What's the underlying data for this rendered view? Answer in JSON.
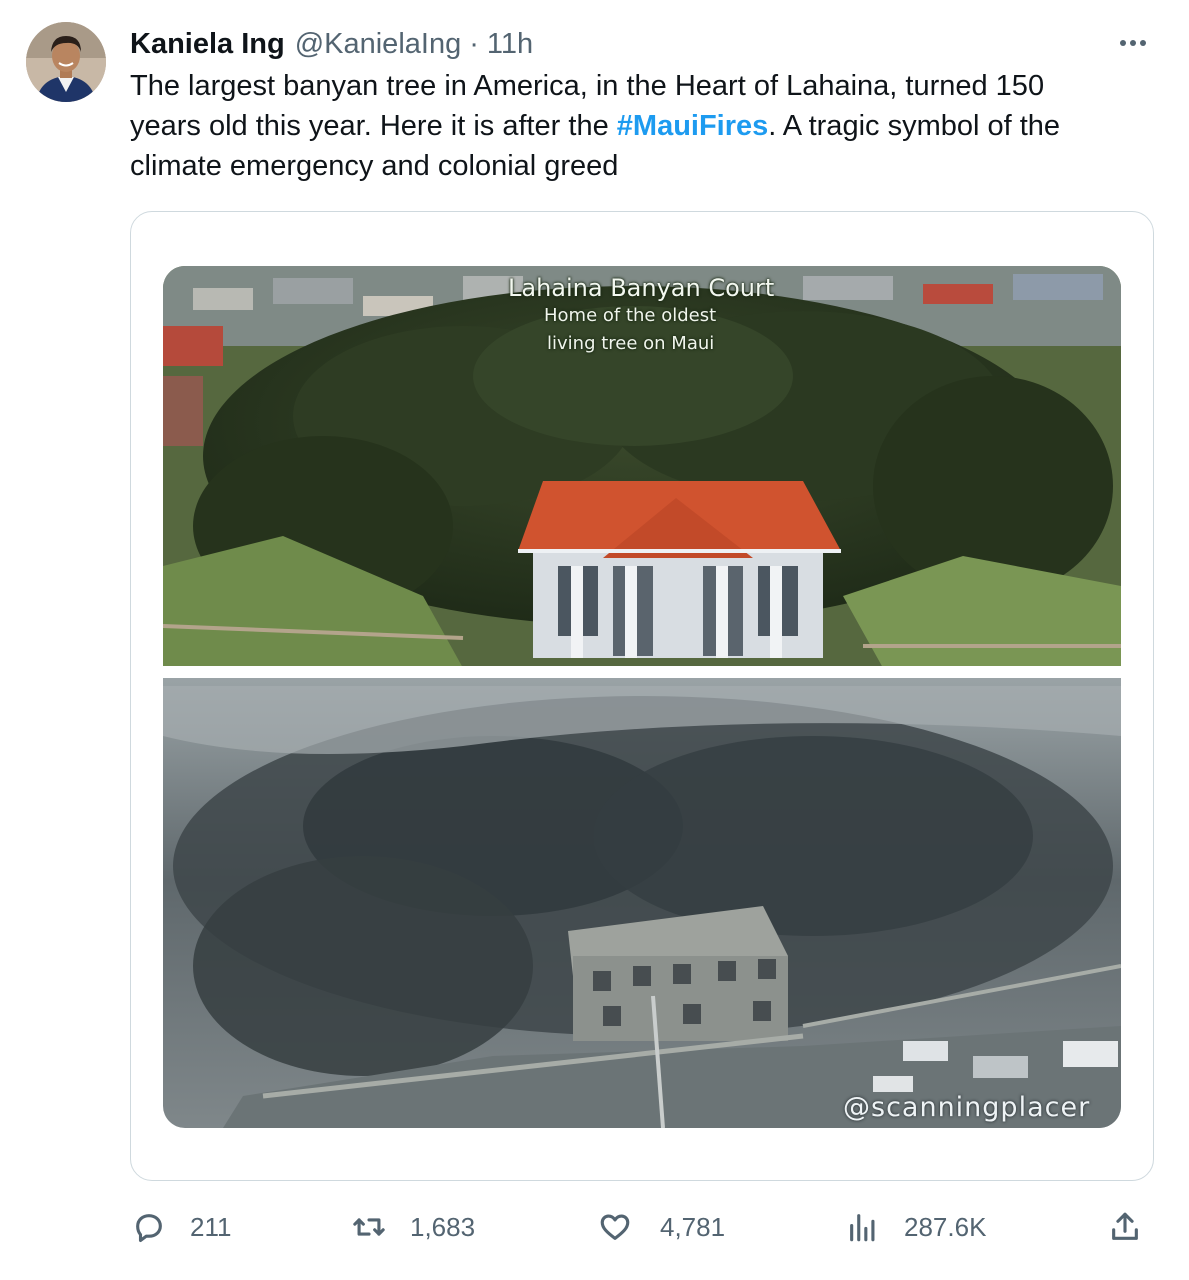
{
  "author": {
    "name": "Kaniela Ing",
    "handle": "@KanielaIng",
    "separator": "·",
    "time": "11h"
  },
  "tweet": {
    "line1": "The largest banyan tree in America, in the Heart of Lahaina, turned 150",
    "line2_before": "years old this year. Here it is after the ",
    "hashtag": "#MauiFires",
    "line2_after": ". A tragic symbol of the",
    "line3": "climate emergency and colonial greed"
  },
  "media": {
    "top_title": "Lahaina Banyan Court",
    "top_sub1": "Home of the oldest",
    "top_sub2": "living tree on Maui",
    "watermark": "@scanningplacer"
  },
  "actions": {
    "replies": "211",
    "retweets": "1,683",
    "likes": "4,781",
    "views": "287.6K"
  },
  "icons": {
    "more": "more-icon",
    "reply": "reply-icon",
    "retweet": "retweet-icon",
    "like": "heart-icon",
    "views": "analytics-icon",
    "share": "share-icon"
  },
  "colors": {
    "link": "#1d9bf0",
    "secondary_text": "#536471",
    "border": "#cfd9de"
  }
}
